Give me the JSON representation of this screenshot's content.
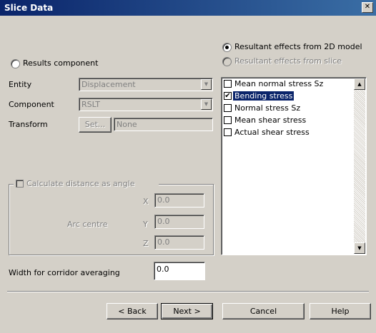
{
  "window": {
    "title": "Slice Data",
    "close_glyph": "✕"
  },
  "mode": {
    "results_component_label": "Results component",
    "resultant_2d_label": "Resultant effects from 2D model",
    "resultant_slice_label": "Resultant effects from slice"
  },
  "entity": {
    "label": "Entity",
    "value": "Displacement"
  },
  "component": {
    "label": "Component",
    "value": "RSLT"
  },
  "transform": {
    "label": "Transform",
    "set_button": "Set...",
    "value": "None"
  },
  "arc": {
    "group_label": "Calculate distance as angle",
    "arc_centre_label": "Arc centre",
    "x_label": "X",
    "x_value": "0.0",
    "y_label": "Y",
    "y_value": "0.0",
    "z_label": "Z",
    "z_value": "0.0"
  },
  "corridor": {
    "label": "Width for corridor averaging",
    "value": "0.0"
  },
  "effects_list": [
    {
      "label": "Mean normal stress Sz",
      "checked": false,
      "selected": false
    },
    {
      "label": "Bending stress",
      "checked": true,
      "selected": true
    },
    {
      "label": "Normal stress Sz",
      "checked": false,
      "selected": false
    },
    {
      "label": "Mean shear stress",
      "checked": false,
      "selected": false
    },
    {
      "label": "Actual shear stress",
      "checked": false,
      "selected": false
    }
  ],
  "buttons": {
    "back": "< Back",
    "next": "Next >",
    "cancel": "Cancel",
    "help": "Help"
  },
  "colors": {
    "title_bar": "#0a246a",
    "selection": "#0a246a",
    "face": "#d4d0c8"
  }
}
